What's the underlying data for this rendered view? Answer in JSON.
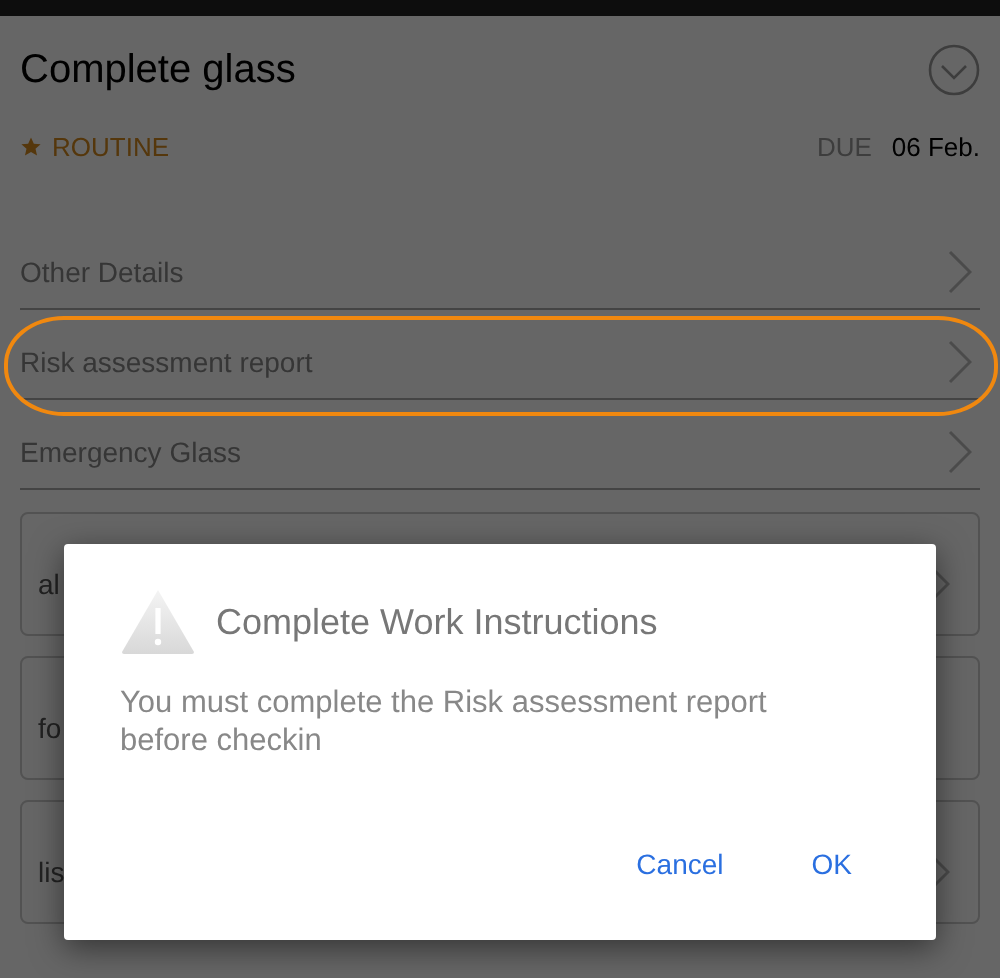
{
  "task": {
    "title": "Complete glass",
    "priority": "ROUTINE",
    "due_label": "DUE",
    "due_date": "06 Feb."
  },
  "sections": [
    {
      "label": "Other Details",
      "highlighted": false
    },
    {
      "label": "Risk assessment report",
      "highlighted": true
    },
    {
      "label": "Emergency Glass",
      "highlighted": false
    }
  ],
  "cards": [
    {
      "text": "al",
      "chevron": true
    },
    {
      "text": "fo",
      "chevron": false
    },
    {
      "text": "lis",
      "chevron": true
    }
  ],
  "dialog": {
    "title": "Complete Work Instructions",
    "message": "You must complete the Risk assessment report before checkin",
    "buttons": [
      "Cancel",
      "OK"
    ]
  }
}
